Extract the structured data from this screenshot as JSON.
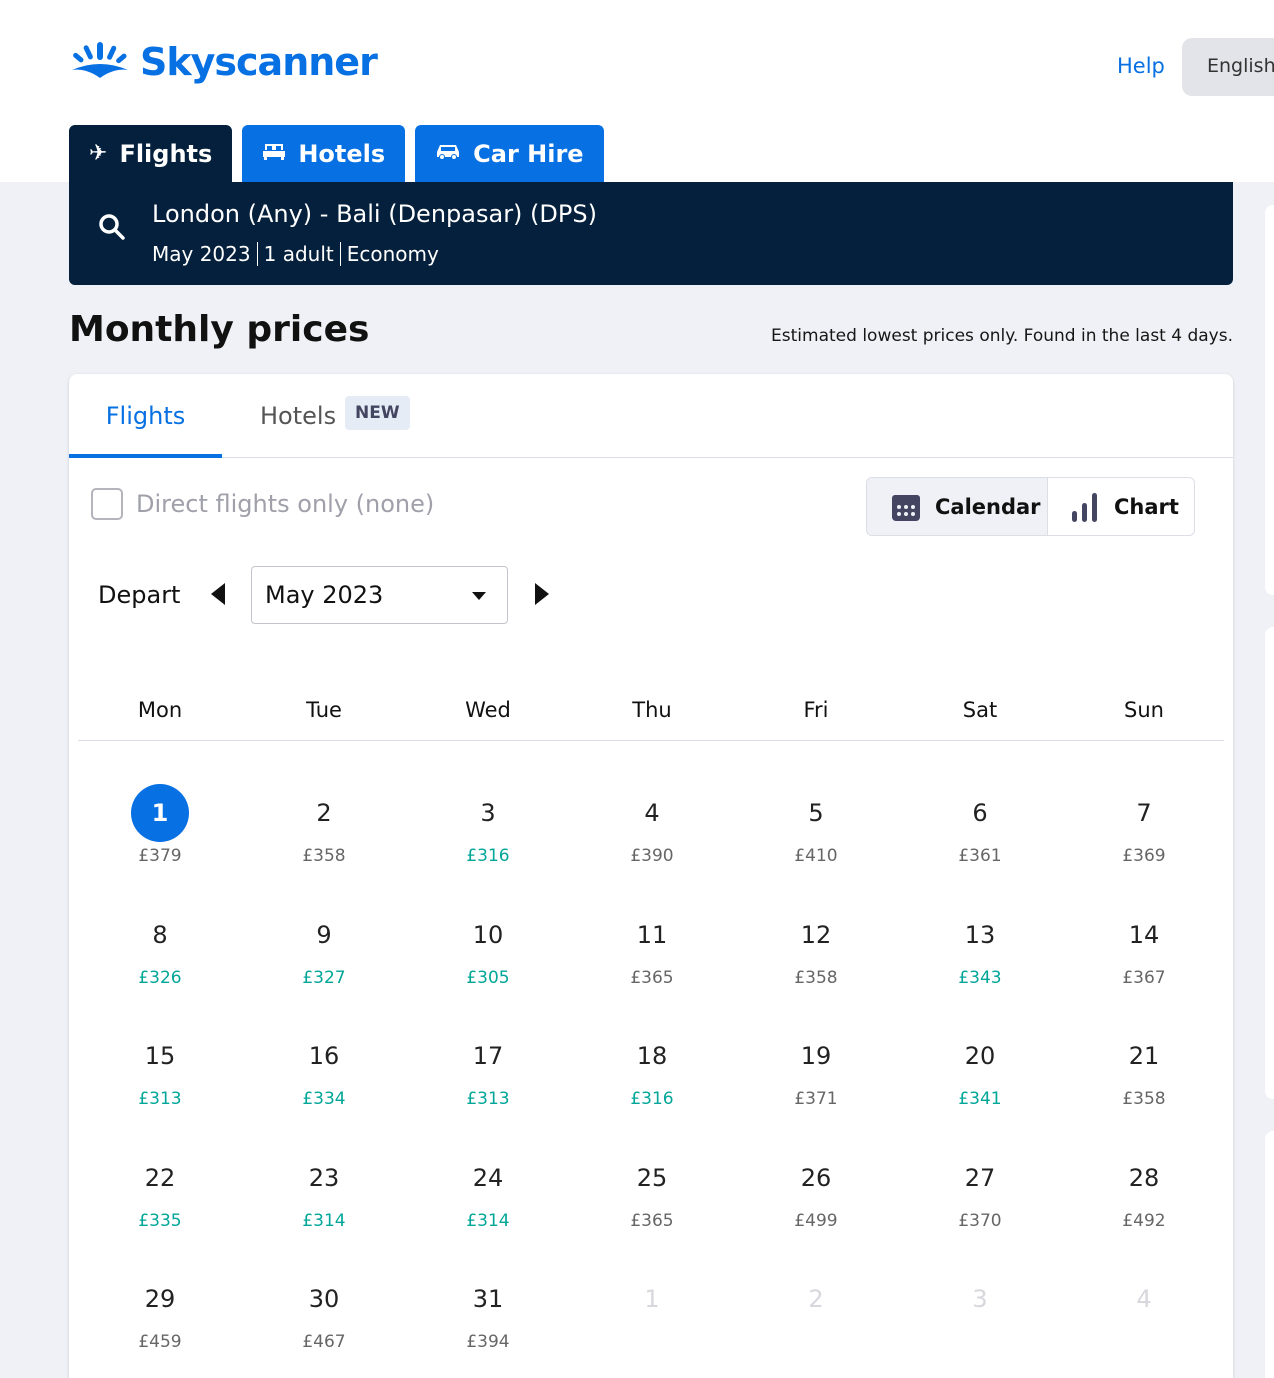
{
  "header": {
    "brand": "Skyscanner",
    "help_label": "Help",
    "language_label": "English",
    "brand_color": "#0770e3"
  },
  "nav_tabs": [
    {
      "label": "Flights",
      "icon": "plane-icon",
      "active": true
    },
    {
      "label": "Hotels",
      "icon": "bed-icon",
      "active": false
    },
    {
      "label": "Car Hire",
      "icon": "car-icon",
      "active": false
    }
  ],
  "search": {
    "route": "London (Any) - Bali (Denpasar) (DPS)",
    "date": "May 2023",
    "travellers": "1 adult",
    "cabin": "Economy"
  },
  "page": {
    "title": "Monthly prices",
    "note": "Estimated lowest prices only. Found in the last 4 days."
  },
  "card": {
    "tab_flights": "Flights",
    "tab_hotels": "Hotels",
    "new_badge": "NEW",
    "direct_label": "Direct flights only (none)",
    "view_calendar": "Calendar",
    "view_chart": "Chart",
    "depart_label": "Depart",
    "selected_month": "May 2023"
  },
  "calendar": {
    "weekdays": [
      "Mon",
      "Tue",
      "Wed",
      "Thu",
      "Fri",
      "Sat",
      "Sun"
    ],
    "selected_day": "1",
    "cheap_color": "#00a698",
    "days": [
      {
        "day": "1",
        "price": "£379",
        "cheap": false,
        "muted": false
      },
      {
        "day": "2",
        "price": "£358",
        "cheap": false,
        "muted": false
      },
      {
        "day": "3",
        "price": "£316",
        "cheap": true,
        "muted": false
      },
      {
        "day": "4",
        "price": "£390",
        "cheap": false,
        "muted": false
      },
      {
        "day": "5",
        "price": "£410",
        "cheap": false,
        "muted": false
      },
      {
        "day": "6",
        "price": "£361",
        "cheap": false,
        "muted": false
      },
      {
        "day": "7",
        "price": "£369",
        "cheap": false,
        "muted": false
      },
      {
        "day": "8",
        "price": "£326",
        "cheap": true,
        "muted": false
      },
      {
        "day": "9",
        "price": "£327",
        "cheap": true,
        "muted": false
      },
      {
        "day": "10",
        "price": "£305",
        "cheap": true,
        "muted": false
      },
      {
        "day": "11",
        "price": "£365",
        "cheap": false,
        "muted": false
      },
      {
        "day": "12",
        "price": "£358",
        "cheap": false,
        "muted": false
      },
      {
        "day": "13",
        "price": "£343",
        "cheap": true,
        "muted": false
      },
      {
        "day": "14",
        "price": "£367",
        "cheap": false,
        "muted": false
      },
      {
        "day": "15",
        "price": "£313",
        "cheap": true,
        "muted": false
      },
      {
        "day": "16",
        "price": "£334",
        "cheap": true,
        "muted": false
      },
      {
        "day": "17",
        "price": "£313",
        "cheap": true,
        "muted": false
      },
      {
        "day": "18",
        "price": "£316",
        "cheap": true,
        "muted": false
      },
      {
        "day": "19",
        "price": "£371",
        "cheap": false,
        "muted": false
      },
      {
        "day": "20",
        "price": "£341",
        "cheap": true,
        "muted": false
      },
      {
        "day": "21",
        "price": "£358",
        "cheap": false,
        "muted": false
      },
      {
        "day": "22",
        "price": "£335",
        "cheap": true,
        "muted": false
      },
      {
        "day": "23",
        "price": "£314",
        "cheap": true,
        "muted": false
      },
      {
        "day": "24",
        "price": "£314",
        "cheap": true,
        "muted": false
      },
      {
        "day": "25",
        "price": "£365",
        "cheap": false,
        "muted": false
      },
      {
        "day": "26",
        "price": "£499",
        "cheap": false,
        "muted": false
      },
      {
        "day": "27",
        "price": "£370",
        "cheap": false,
        "muted": false
      },
      {
        "day": "28",
        "price": "£492",
        "cheap": false,
        "muted": false
      },
      {
        "day": "29",
        "price": "£459",
        "cheap": false,
        "muted": false
      },
      {
        "day": "30",
        "price": "£467",
        "cheap": false,
        "muted": false
      },
      {
        "day": "31",
        "price": "£394",
        "cheap": false,
        "muted": false
      },
      {
        "day": "1",
        "price": "",
        "cheap": false,
        "muted": true
      },
      {
        "day": "2",
        "price": "",
        "cheap": false,
        "muted": true
      },
      {
        "day": "3",
        "price": "",
        "cheap": false,
        "muted": true
      },
      {
        "day": "4",
        "price": "",
        "cheap": false,
        "muted": true
      }
    ]
  }
}
